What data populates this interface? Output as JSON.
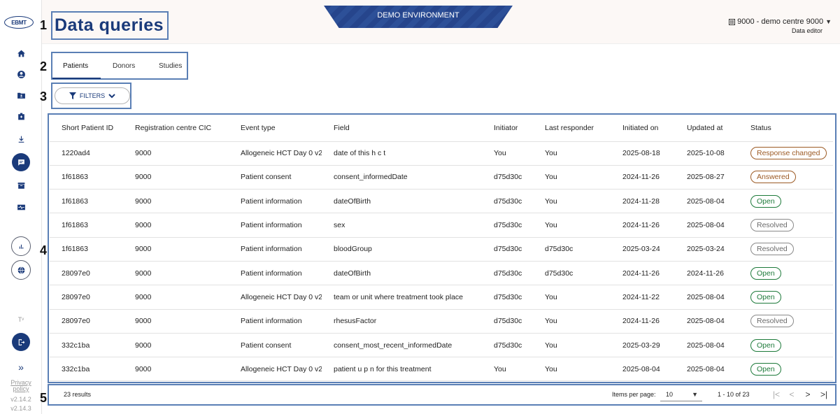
{
  "logo_text": "EBMT",
  "header": {
    "title": "Data queries",
    "banner": "DEMO ENVIRONMENT",
    "centre": "9000 - demo centre 9000",
    "role": "Data editor"
  },
  "steps": [
    "1",
    "2",
    "3",
    "4",
    "5"
  ],
  "sidebar": {
    "icons": [
      "home-icon",
      "account-icon",
      "folder-user-icon",
      "medical-bag-icon",
      "download-icon",
      "message-icon",
      "archive-icon",
      "health-card-icon",
      "bar-chart-icon",
      "globe-icon",
      "logout-icon"
    ],
    "text_size_toggle": "Tᵛ",
    "expand": "»",
    "privacy": "Privacy policy",
    "version1": "v2.14.2",
    "version2": "v2.14.3"
  },
  "tabs": [
    {
      "label": "Patients",
      "active": true
    },
    {
      "label": "Donors",
      "active": false
    },
    {
      "label": "Studies",
      "active": false
    }
  ],
  "filters_label": "FILTERS",
  "table": {
    "headers": [
      "Short Patient ID",
      "Registration centre CIC",
      "Event type",
      "Field",
      "Initiator",
      "Last responder",
      "Initiated on",
      "Updated at",
      "Status"
    ],
    "rows": [
      {
        "id": "1220ad4",
        "cic": "9000",
        "event": "Allogeneic HCT Day 0 v2",
        "field": "date of this h c t",
        "initiator": "You",
        "responder": "You",
        "initiated": "2025-08-18",
        "updated": "2025-10-08",
        "status": "Response changed",
        "status_type": "changed"
      },
      {
        "id": "1f61863",
        "cic": "9000",
        "event": "Patient consent",
        "field": "consent_informedDate",
        "initiator": "d75d30c",
        "responder": "You",
        "initiated": "2024-11-26",
        "updated": "2025-08-27",
        "status": "Answered",
        "status_type": "answered"
      },
      {
        "id": "1f61863",
        "cic": "9000",
        "event": "Patient information",
        "field": "dateOfBirth",
        "initiator": "d75d30c",
        "responder": "You",
        "initiated": "2024-11-28",
        "updated": "2025-08-04",
        "status": "Open",
        "status_type": "open"
      },
      {
        "id": "1f61863",
        "cic": "9000",
        "event": "Patient information",
        "field": "sex",
        "initiator": "d75d30c",
        "responder": "You",
        "initiated": "2024-11-26",
        "updated": "2025-08-04",
        "status": "Resolved",
        "status_type": "resolved"
      },
      {
        "id": "1f61863",
        "cic": "9000",
        "event": "Patient information",
        "field": "bloodGroup",
        "initiator": "d75d30c",
        "responder": "d75d30c",
        "initiated": "2025-03-24",
        "updated": "2025-03-24",
        "status": "Resolved",
        "status_type": "resolved"
      },
      {
        "id": "28097e0",
        "cic": "9000",
        "event": "Patient information",
        "field": "dateOfBirth",
        "initiator": "d75d30c",
        "responder": "d75d30c",
        "initiated": "2024-11-26",
        "updated": "2024-11-26",
        "status": "Open",
        "status_type": "open"
      },
      {
        "id": "28097e0",
        "cic": "9000",
        "event": "Allogeneic HCT Day 0 v2",
        "field": "team or unit where treatment took place",
        "initiator": "d75d30c",
        "responder": "You",
        "initiated": "2024-11-22",
        "updated": "2025-08-04",
        "status": "Open",
        "status_type": "open"
      },
      {
        "id": "28097e0",
        "cic": "9000",
        "event": "Patient information",
        "field": "rhesusFactor",
        "initiator": "d75d30c",
        "responder": "You",
        "initiated": "2024-11-26",
        "updated": "2025-08-04",
        "status": "Resolved",
        "status_type": "resolved"
      },
      {
        "id": "332c1ba",
        "cic": "9000",
        "event": "Patient consent",
        "field": "consent_most_recent_informedDate",
        "initiator": "d75d30c",
        "responder": "You",
        "initiated": "2025-03-29",
        "updated": "2025-08-04",
        "status": "Open",
        "status_type": "open"
      },
      {
        "id": "332c1ba",
        "cic": "9000",
        "event": "Allogeneic HCT Day 0 v2",
        "field": "patient u p n for this treatment",
        "initiator": "You",
        "responder": "You",
        "initiated": "2025-08-04",
        "updated": "2025-08-04",
        "status": "Open",
        "status_type": "open"
      }
    ]
  },
  "paginator": {
    "results": "23 results",
    "items_per_page_label": "Items per page:",
    "items_per_page": "10",
    "range": "1 - 10 of 23",
    "first": "|<",
    "prev": "<",
    "next": ">",
    "last": ">|"
  }
}
